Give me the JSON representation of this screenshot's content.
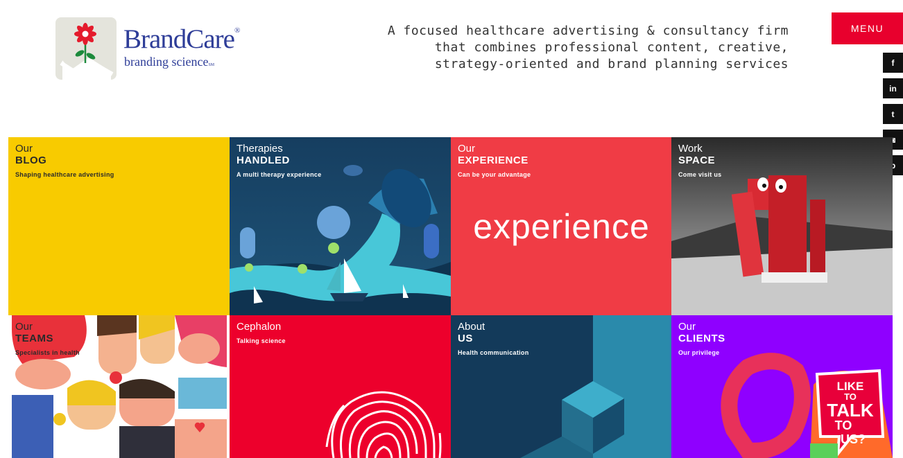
{
  "brand": {
    "name": "BrandCare",
    "registered": "®",
    "tagline": "branding science",
    "service_mark": "SM"
  },
  "header": {
    "description": "A focused healthcare advertising & consultancy firm that combines professional content, creative, strategy-oriented and brand planning services",
    "menu_label": "MENU"
  },
  "social": [
    {
      "icon": "facebook-icon",
      "glyph": "f"
    },
    {
      "icon": "linkedin-icon",
      "glyph": "in"
    },
    {
      "icon": "twitter-icon",
      "glyph": "t"
    },
    {
      "icon": "instagram-icon",
      "glyph": "◙"
    },
    {
      "icon": "pinterest-icon",
      "glyph": "p"
    }
  ],
  "tiles": [
    {
      "small": "Our",
      "big": "BLOG",
      "sub": "Shaping healthcare advertising",
      "color": "#f8cb00"
    },
    {
      "small": "Therapies",
      "big": "HANDLED",
      "sub": "A multi therapy experience",
      "color": "#1b4a6b"
    },
    {
      "small": "Our",
      "big": "EXPERIENCE",
      "sub": "Can be your advantage",
      "color": "#f03c45",
      "art_text": "experience"
    },
    {
      "small": "Work",
      "big": "SPACE",
      "sub": "Come visit us",
      "color": "#5a5a5a"
    },
    {
      "small": "Our",
      "big": "TEAMS",
      "sub": "Specialists in health",
      "color": "#ffffff"
    },
    {
      "small": "Cephalon",
      "big": "",
      "sub": "Talking science",
      "color": "#ed002c"
    },
    {
      "small": "About",
      "big": "US",
      "sub": "Health communication",
      "color": "#133a5a"
    },
    {
      "small": "Our",
      "big": "CLIENTS",
      "sub": "Our privilege",
      "color": "#8f00ff",
      "art_text": [
        "LIKE",
        "TO",
        "TALK",
        "TO",
        "US?"
      ]
    }
  ]
}
